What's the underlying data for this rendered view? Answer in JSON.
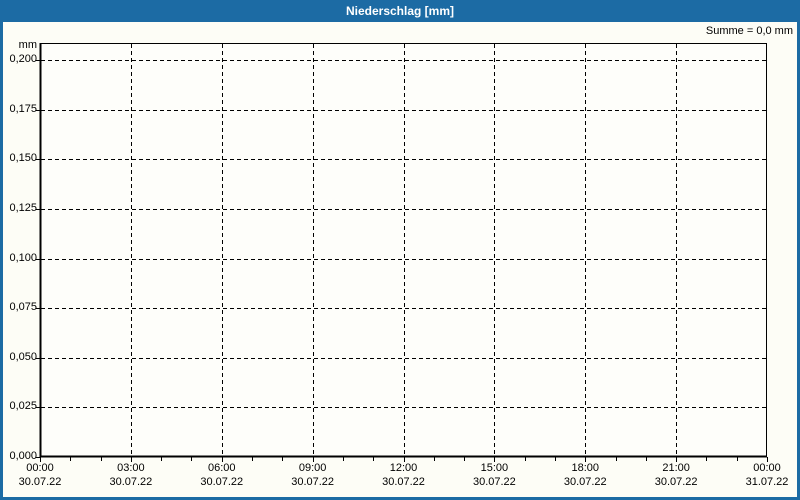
{
  "window": {
    "title": "Niederschlag [mm]"
  },
  "header": {
    "summary": "Summe = 0,0 mm"
  },
  "colors": {
    "accent": "#1C6BA4",
    "title_text": "#FFFFFF",
    "axis_and_grid": "#000000",
    "background": "#FDFDF6",
    "plot_background": "#FEFEFA"
  },
  "chart_data": {
    "type": "line",
    "title": "Niederschlag [mm]",
    "subtitle": "Summe = 0,0 mm",
    "xlabel": "",
    "ylabel": "mm",
    "y_unit_label": "mm",
    "ylim": [
      0,
      0.2086
    ],
    "grid": "dashed",
    "legend_position": "none",
    "y_ticks": [
      {
        "value": 0.0,
        "label": "0,000"
      },
      {
        "value": 0.025,
        "label": "0,025"
      },
      {
        "value": 0.05,
        "label": "0,050"
      },
      {
        "value": 0.075,
        "label": "0,075"
      },
      {
        "value": 0.1,
        "label": "0,100"
      },
      {
        "value": 0.125,
        "label": "0,125"
      },
      {
        "value": 0.15,
        "label": "0,150"
      },
      {
        "value": 0.175,
        "label": "0,175"
      },
      {
        "value": 0.2,
        "label": "0,200"
      }
    ],
    "x_axis": {
      "span_hours": 24,
      "minor_tick_interval_hours": 1,
      "major_tick_interval_hours": 3,
      "major_ticks": [
        {
          "hour": 0,
          "time": "00:00",
          "date": "30.07.22"
        },
        {
          "hour": 3,
          "time": "03:00",
          "date": "30.07.22"
        },
        {
          "hour": 6,
          "time": "06:00",
          "date": "30.07.22"
        },
        {
          "hour": 9,
          "time": "09:00",
          "date": "30.07.22"
        },
        {
          "hour": 12,
          "time": "12:00",
          "date": "30.07.22"
        },
        {
          "hour": 15,
          "time": "15:00",
          "date": "30.07.22"
        },
        {
          "hour": 18,
          "time": "18:00",
          "date": "30.07.22"
        },
        {
          "hour": 21,
          "time": "21:00",
          "date": "30.07.22"
        },
        {
          "hour": 24,
          "time": "00:00",
          "date": "31.07.22"
        }
      ]
    },
    "series": [
      {
        "name": "Niederschlag",
        "values": []
      }
    ],
    "sum_label": "Summe = 0,0 mm"
  }
}
